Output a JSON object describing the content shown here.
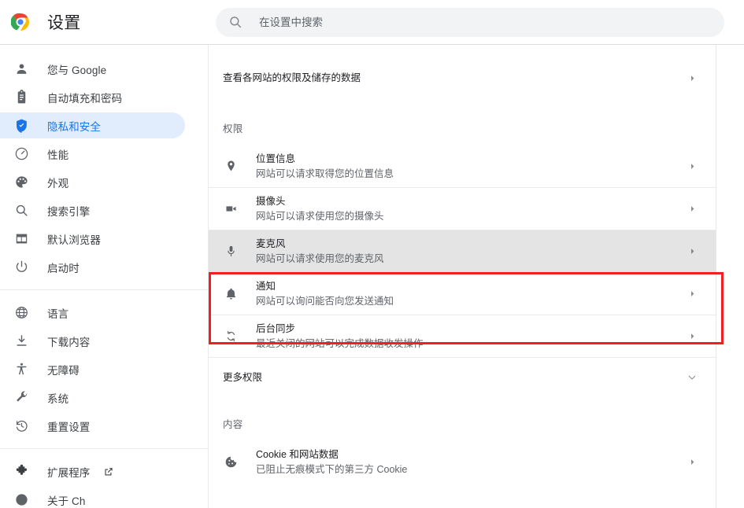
{
  "header": {
    "logo_icon": "chrome-logo-icon",
    "title": "设置",
    "search": {
      "icon": "search-icon",
      "placeholder": "在设置中搜索",
      "value": ""
    }
  },
  "sidebar": {
    "groups": [
      {
        "items": [
          {
            "icon": "person-icon",
            "label": "您与 Google",
            "selected": false,
            "external": false
          },
          {
            "icon": "clipboard-icon",
            "label": "自动填充和密码",
            "selected": false,
            "external": false
          },
          {
            "icon": "shield-icon",
            "label": "隐私和安全",
            "selected": true,
            "external": false
          },
          {
            "icon": "speedometer-icon",
            "label": "性能",
            "selected": false,
            "external": false
          },
          {
            "icon": "palette-icon",
            "label": "外观",
            "selected": false,
            "external": false
          },
          {
            "icon": "search-icon",
            "label": "搜索引擎",
            "selected": false,
            "external": false
          },
          {
            "icon": "browser-icon",
            "label": "默认浏览器",
            "selected": false,
            "external": false
          },
          {
            "icon": "power-icon",
            "label": "启动时",
            "selected": false,
            "external": false
          }
        ]
      },
      {
        "items": [
          {
            "icon": "globe-icon",
            "label": "语言",
            "selected": false,
            "external": false
          },
          {
            "icon": "download-icon",
            "label": "下载内容",
            "selected": false,
            "external": false
          },
          {
            "icon": "accessibility-icon",
            "label": "无障碍",
            "selected": false,
            "external": false
          },
          {
            "icon": "wrench-icon",
            "label": "系统",
            "selected": false,
            "external": false
          },
          {
            "icon": "history-restore-icon",
            "label": "重置设置",
            "selected": false,
            "external": false
          }
        ]
      },
      {
        "items": [
          {
            "icon": "puzzle-icon",
            "label": "扩展程序",
            "selected": false,
            "external": true,
            "external_icon": "open-in-new-icon"
          },
          {
            "icon": "chrome-logo-icon",
            "label": "关于 Ch",
            "selected": false,
            "external": false
          }
        ]
      }
    ]
  },
  "main": {
    "site_settings_row": {
      "title": "查看各网站的权限及储存的数据",
      "arrow_icon": "chevron-right-icon"
    },
    "permissions_section": {
      "heading": "权限",
      "rows": [
        {
          "icon": "location-pin-icon",
          "title": "位置信息",
          "subtitle": "网站可以请求取得您的位置信息",
          "arrow_icon": "chevron-right-icon",
          "hovered": false
        },
        {
          "icon": "camera-icon",
          "title": "摄像头",
          "subtitle": "网站可以请求使用您的摄像头",
          "arrow_icon": "chevron-right-icon",
          "hovered": false
        },
        {
          "icon": "microphone-icon",
          "title": "麦克风",
          "subtitle": "网站可以请求使用您的麦克风",
          "arrow_icon": "chevron-right-icon",
          "hovered": true
        },
        {
          "icon": "bell-icon",
          "title": "通知",
          "subtitle": "网站可以询问能否向您发送通知",
          "arrow_icon": "chevron-right-icon",
          "hovered": false
        },
        {
          "icon": "sync-icon",
          "title": "后台同步",
          "subtitle": "最近关闭的网站可以完成数据收发操作",
          "arrow_icon": "chevron-right-icon",
          "hovered": false
        }
      ],
      "more_permissions": {
        "label": "更多权限",
        "arrow_icon": "chevron-down-icon"
      }
    },
    "content_section": {
      "heading": "内容",
      "rows": [
        {
          "icon": "cookie-icon",
          "title": "Cookie 和网站数据",
          "subtitle": "已阻止无痕模式下的第三方 Cookie",
          "arrow_icon": "chevron-right-icon",
          "hovered": false
        }
      ]
    }
  },
  "annotation": {
    "highlight_color": "#f02020",
    "target": "麦克风"
  }
}
